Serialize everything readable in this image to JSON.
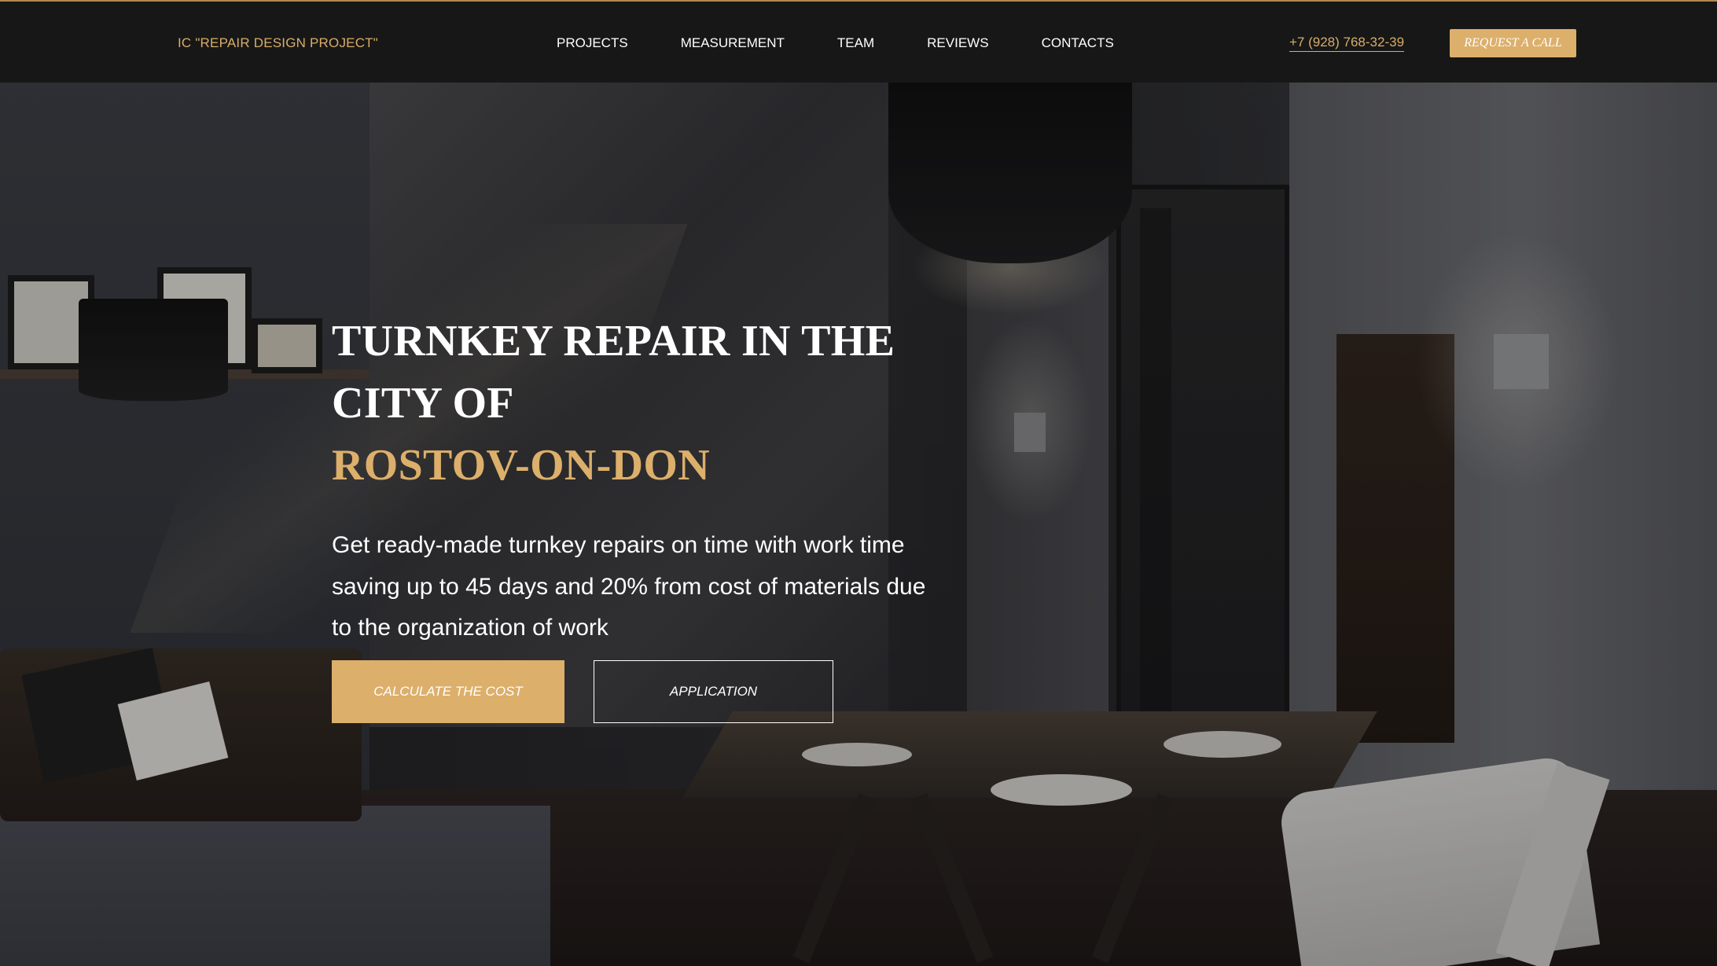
{
  "header": {
    "logo": "IC \"REPAIR DESIGN PROJECT\"",
    "nav": [
      {
        "label": "PROJECTS"
      },
      {
        "label": "MEASUREMENT"
      },
      {
        "label": "TEAM"
      },
      {
        "label": "REVIEWS"
      },
      {
        "label": "CONTACTS"
      }
    ],
    "phone": "+7 (928) 768-32-39",
    "cta_label": "REQUEST A CALL"
  },
  "hero": {
    "title_line1": "TURNKEY REPAIR IN THE",
    "title_line2": "CITY OF",
    "title_accent": "ROSTOV-ON-DON",
    "description": "Get ready-made turnkey repairs on time with work time saving up to 45 days and 20% from cost of materials due to the organization of work",
    "primary_button": "CALCULATE THE COST",
    "secondary_button": "APPLICATION"
  },
  "colors": {
    "accent": "#dcaf6b",
    "header_bg": "#171717",
    "text_light": "#ffffff"
  }
}
